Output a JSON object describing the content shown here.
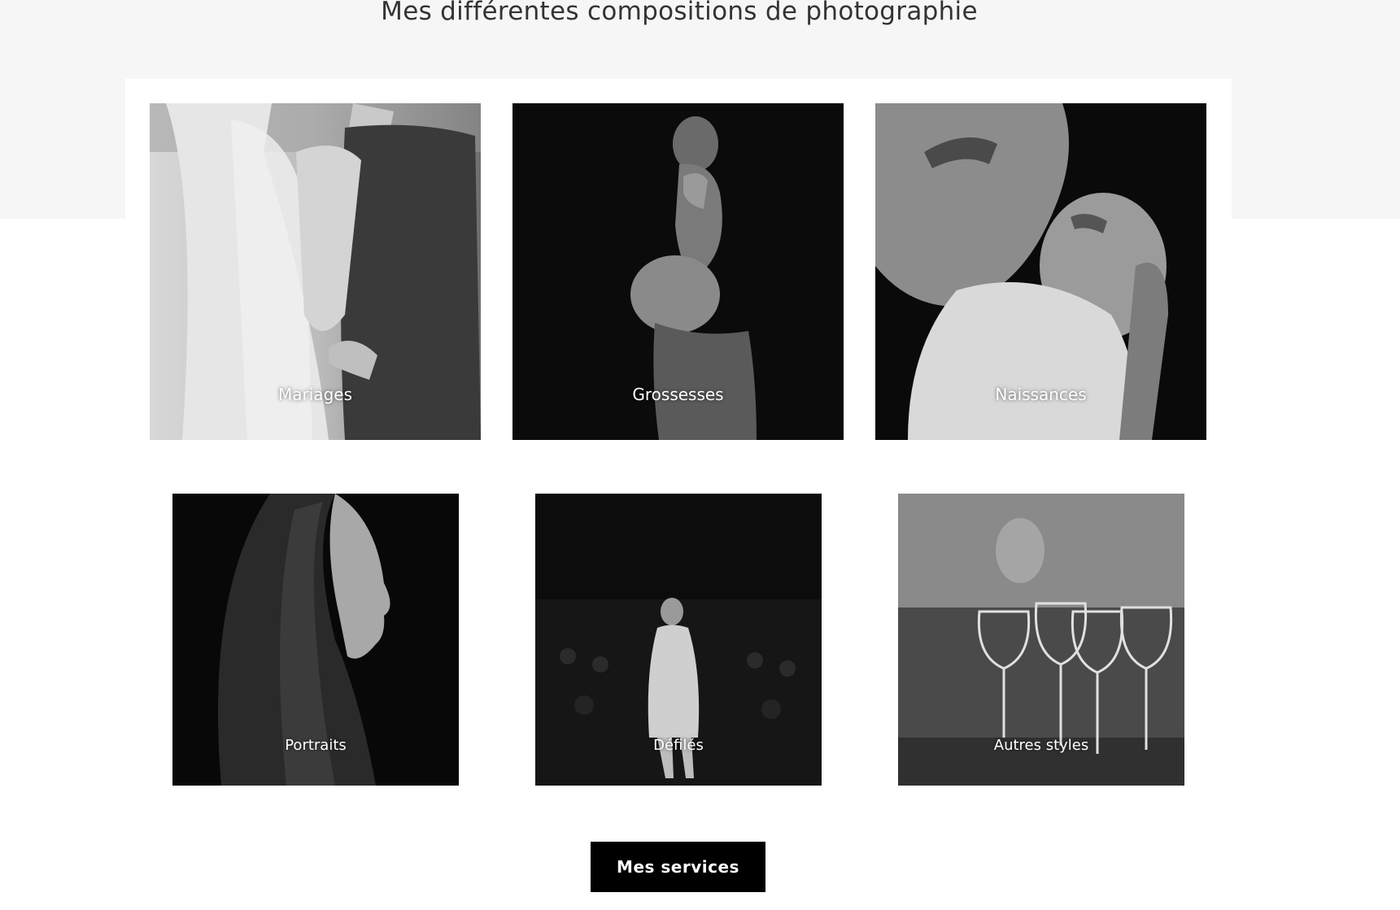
{
  "section": {
    "title": "Mes différentes compositions de photographie"
  },
  "gallery": [
    {
      "label": "Mariages"
    },
    {
      "label": "Grossesses"
    },
    {
      "label": "Naissances"
    },
    {
      "label": "Portraits"
    },
    {
      "label": "Défilés"
    },
    {
      "label": "Autres styles"
    }
  ],
  "cta": {
    "label": "Mes services"
  },
  "colors": {
    "band": "#f6f6f6",
    "button_bg": "#000000",
    "button_text": "#ffffff",
    "heading": "#333333"
  }
}
